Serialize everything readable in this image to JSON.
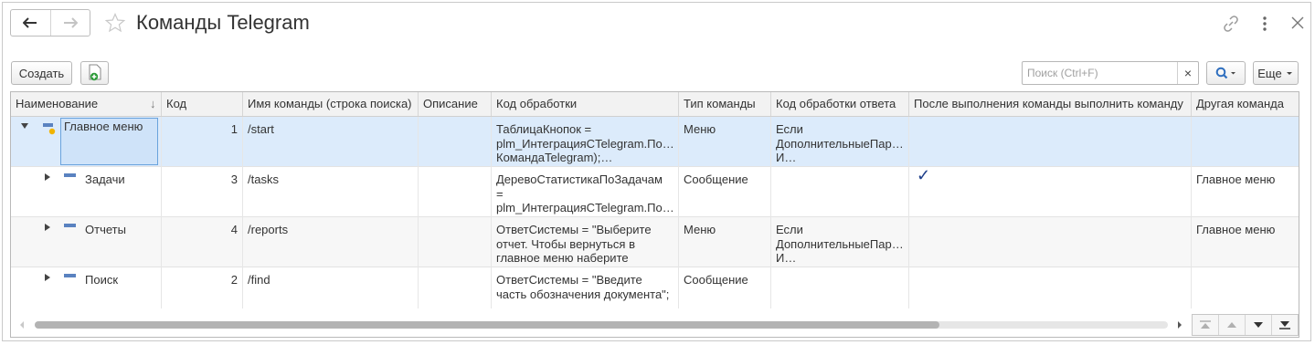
{
  "title": "Команды Telegram",
  "toolbar": {
    "create_label": "Создать",
    "search_placeholder": "Поиск (Ctrl+F)",
    "clear_label": "×",
    "more_label": "Еще"
  },
  "table": {
    "columns": [
      "Наименование",
      "Код",
      "Имя команды (строка поиска)",
      "Описание",
      "Код обработки",
      "Тип команды",
      "Код обработки ответа",
      "После выполнения команды выполнить команду",
      "Другая команда"
    ],
    "rows": [
      {
        "name": "Главное меню",
        "code": "1",
        "command": "/start",
        "description": "",
        "handler": [
          "ТаблицаКнопок =",
          "plm_ИнтеграцияCTelegram.По…",
          "КомандаTelegram);…"
        ],
        "type": "Меню",
        "answer": [
          "Если",
          "ДополнительныеПар…",
          "И…"
        ],
        "after": "",
        "other": ""
      },
      {
        "name": "Задачи",
        "code": "3",
        "command": "/tasks",
        "description": "",
        "handler": [
          "ДеревоСтатистикаПоЗадачам",
          "=",
          "plm_ИнтеграцияCTelegram.По…"
        ],
        "type": "Сообщение",
        "answer": [],
        "after": "✓",
        "other": "Главное меню"
      },
      {
        "name": "Отчеты",
        "code": "4",
        "command": "/reports",
        "description": "",
        "handler": [
          "ОтветСистемы = \"Выберите",
          "отчет. Чтобы вернуться в",
          "главное меню наберите"
        ],
        "type": "Меню",
        "answer": [
          "Если",
          "ДополнительныеПар…",
          "И…"
        ],
        "after": "",
        "other": "Главное меню"
      },
      {
        "name": "Поиск",
        "code": "2",
        "command": "/find",
        "description": "",
        "handler": [
          "ОтветСистемы = \"Введите",
          "часть обозначения документа\";"
        ],
        "type": "Сообщение",
        "answer": [],
        "after": "",
        "other": ""
      }
    ]
  }
}
